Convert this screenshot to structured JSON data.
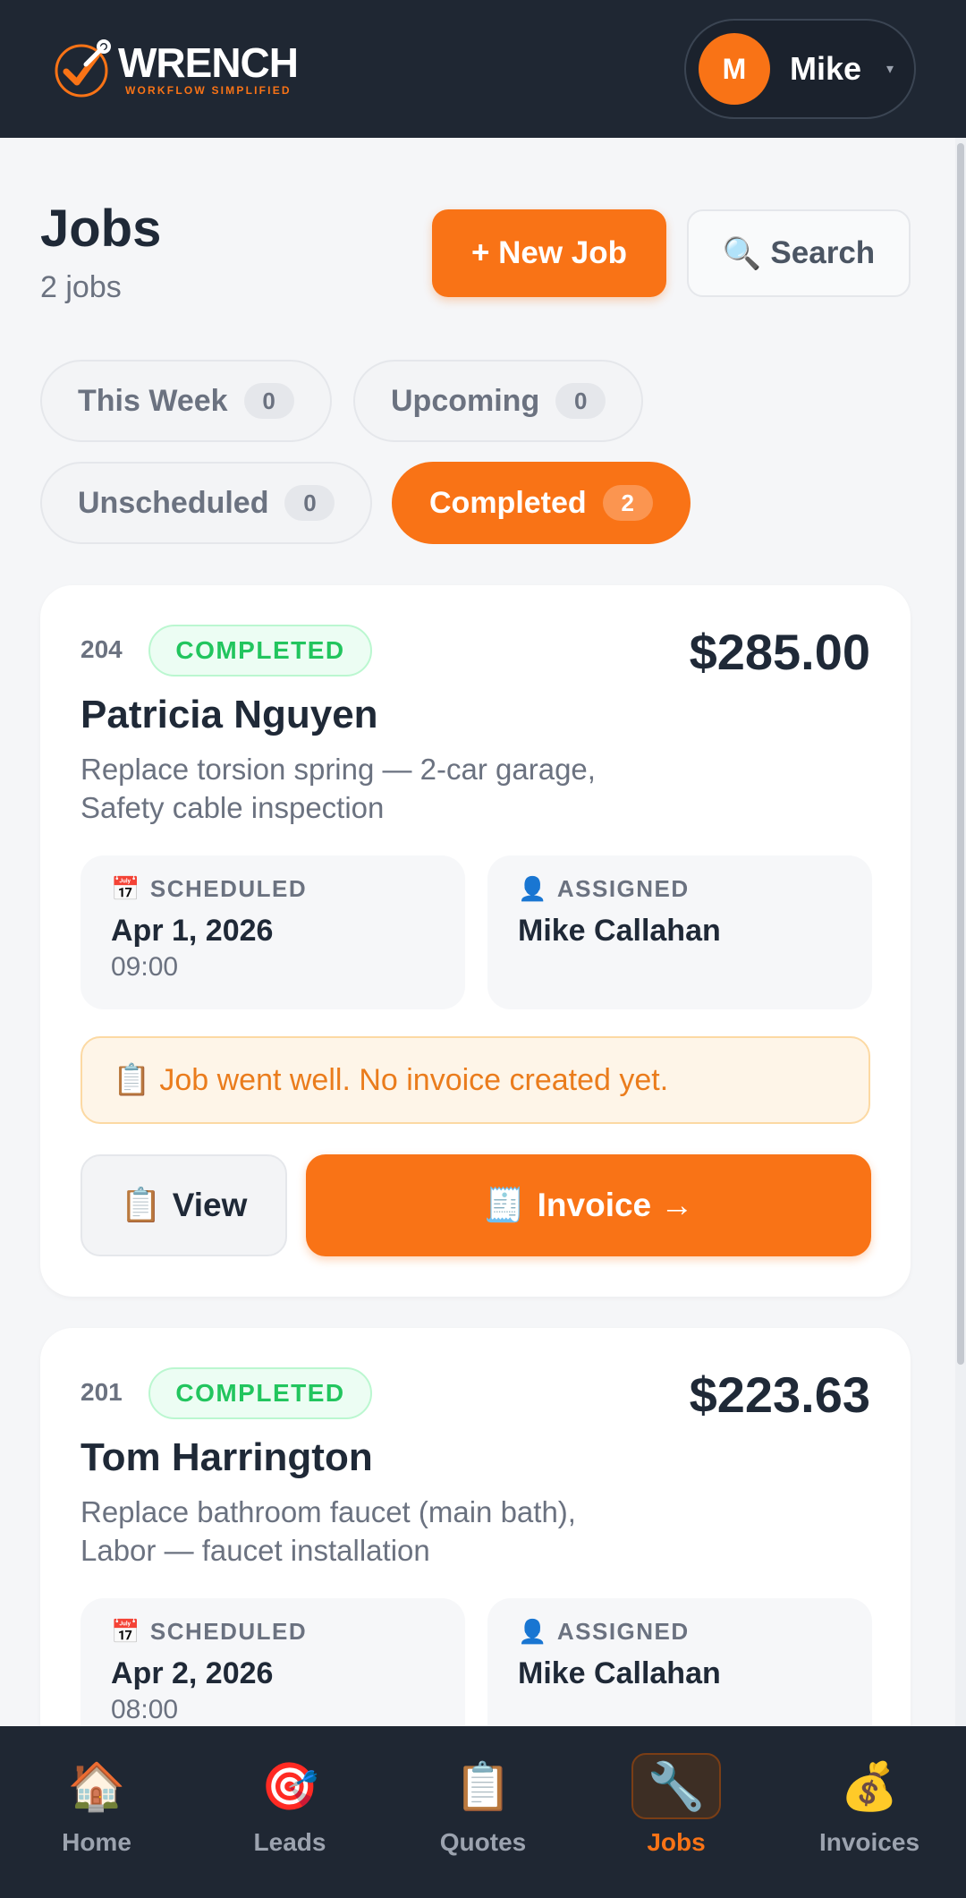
{
  "app": {
    "brand_name": "WRENCH",
    "brand_tagline": "WORKFLOW SIMPLIFIED",
    "accent_color": "#f97316"
  },
  "user": {
    "initial": "M",
    "name": "Mike",
    "caret": "▾"
  },
  "page": {
    "title": "Jobs",
    "subtitle": "2 jobs",
    "new_job_label": "+ New Job",
    "search_label": "Search",
    "search_icon": "🔍"
  },
  "filters": [
    {
      "label": "This Week",
      "count": "0",
      "active": false
    },
    {
      "label": "Upcoming",
      "count": "0",
      "active": false
    },
    {
      "label": "Unscheduled",
      "count": "0",
      "active": false
    },
    {
      "label": "Completed",
      "count": "2",
      "active": true
    }
  ],
  "jobs": [
    {
      "number": "204",
      "status": "COMPLETED",
      "amount": "$285.00",
      "customer": "Patricia Nguyen",
      "description_line1": "Replace torsion spring — 2-car garage,",
      "description_line2": "Safety cable inspection",
      "scheduled_label": "SCHEDULED",
      "scheduled_date": "Apr 1, 2026",
      "scheduled_time": "09:00",
      "assigned_label": "ASSIGNED",
      "assigned_to": "Mike Callahan",
      "note": "Job went well. No invoice created yet.",
      "view_label": "View",
      "invoice_label": "Invoice →"
    },
    {
      "number": "201",
      "status": "COMPLETED",
      "amount": "$223.63",
      "customer": "Tom Harrington",
      "description_line1": "Replace bathroom faucet (main bath),",
      "description_line2": "Labor — faucet installation",
      "scheduled_label": "SCHEDULED",
      "scheduled_date": "Apr 2, 2026",
      "scheduled_time": "08:00",
      "assigned_label": "ASSIGNED",
      "assigned_to": "Mike Callahan"
    }
  ],
  "icons": {
    "calendar": "📅",
    "person": "👤",
    "clipboard": "📋",
    "receipt": "🧾"
  },
  "nav": [
    {
      "label": "Home",
      "icon": "🏠",
      "active": false
    },
    {
      "label": "Leads",
      "icon": "🎯",
      "active": false
    },
    {
      "label": "Quotes",
      "icon": "📋",
      "active": false
    },
    {
      "label": "Jobs",
      "icon": "🔧",
      "active": true
    },
    {
      "label": "Invoices",
      "icon": "💰",
      "active": false
    }
  ]
}
